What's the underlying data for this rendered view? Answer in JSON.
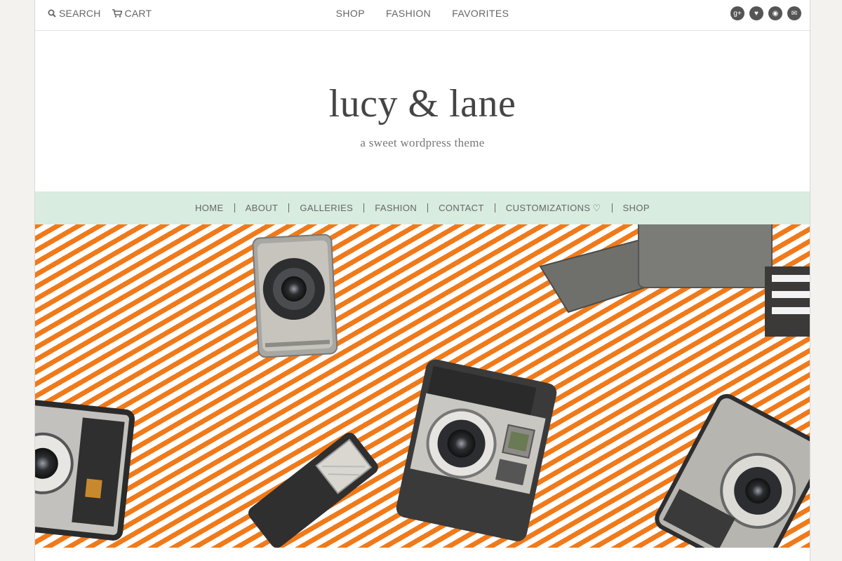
{
  "topbar": {
    "search_label": "SEARCH",
    "cart_label": "CART",
    "center_links": [
      "SHOP",
      "FASHION",
      "FAVORITES"
    ],
    "social": [
      {
        "icon": "google-plus-icon",
        "glyph": "g+"
      },
      {
        "icon": "heart-icon",
        "glyph": "♥"
      },
      {
        "icon": "rss-icon",
        "glyph": "◉"
      },
      {
        "icon": "mail-icon",
        "glyph": "✉"
      }
    ]
  },
  "header": {
    "logo": "lucy & lane",
    "tagline": "a sweet wordpress theme"
  },
  "nav": {
    "items": [
      "HOME",
      "ABOUT",
      "GALLERIES",
      "FASHION",
      "CONTACT",
      "CUSTOMIZATIONS",
      "SHOP"
    ],
    "heart_glyph": "♡"
  },
  "hero": {
    "stripe_color": "#f07a1a",
    "camera_body_color": "#b9b7b2",
    "camera_dark_color": "#3a3a3a"
  }
}
